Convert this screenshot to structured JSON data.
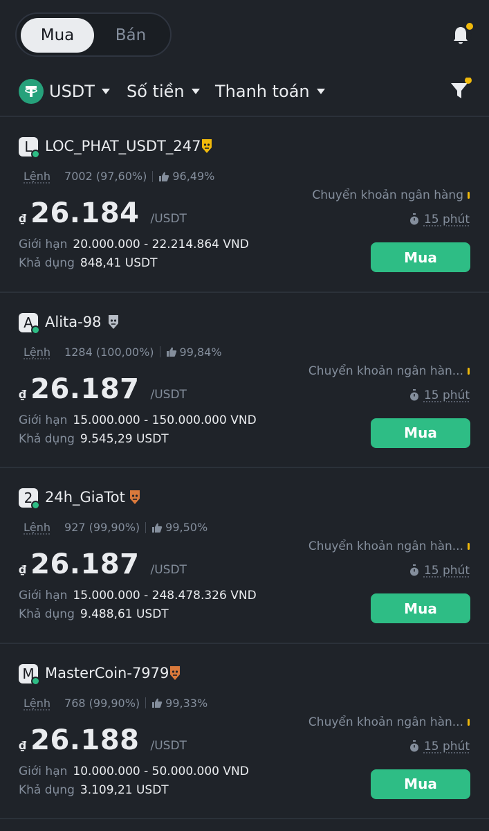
{
  "tabs": {
    "buy": "Mua",
    "sell": "Bán"
  },
  "filters": {
    "asset": "USDT",
    "amount": "Số tiền",
    "payment": "Thanh toán"
  },
  "colors": {
    "buy_green": "#2ebd85",
    "notice_yellow": "#f0b90b",
    "tether_green": "#26a17b"
  },
  "labels": {
    "orders": "Lệnh",
    "limit": "Giới hạn",
    "available": "Khả dụng",
    "per_unit": "/USDT",
    "currency_symbol": "₫",
    "buy_button": "Mua"
  },
  "offers": [
    {
      "initial": "L",
      "merchant": "LOC_PHAT_USDT_247",
      "badge": "gold",
      "orders": "7002 (97,60%)",
      "rating": "96,49%",
      "price": "26.184",
      "limit": "20.000.000 - 22.214.864 VND",
      "available": "848,41 USDT",
      "payment": "Chuyển khoản ngân hàng",
      "time": "15 phút"
    },
    {
      "initial": "A",
      "merchant": "Alita-98",
      "badge": "silver",
      "orders": "1284 (100,00%)",
      "rating": "99,84%",
      "price": "26.187",
      "limit": "15.000.000 - 150.000.000 VND",
      "available": "9.545,29 USDT",
      "payment": "Chuyển khoản ngân hàn...",
      "time": "15 phút"
    },
    {
      "initial": "2",
      "merchant": "24h_GiaTot",
      "badge": "bronze",
      "orders": "927 (99,90%)",
      "rating": "99,50%",
      "price": "26.187",
      "limit": "15.000.000 - 248.478.326 VND",
      "available": "9.488,61 USDT",
      "payment": "Chuyển khoản ngân hàn...",
      "time": "15 phút"
    },
    {
      "initial": "M",
      "merchant": "MasterCoin-7979",
      "badge": "bronze",
      "orders": "768 (99,90%)",
      "rating": "99,33%",
      "price": "26.188",
      "limit": "10.000.000 - 50.000.000 VND",
      "available": "3.109,21 USDT",
      "payment": "Chuyển khoản ngân hàn...",
      "time": "15 phút"
    }
  ]
}
